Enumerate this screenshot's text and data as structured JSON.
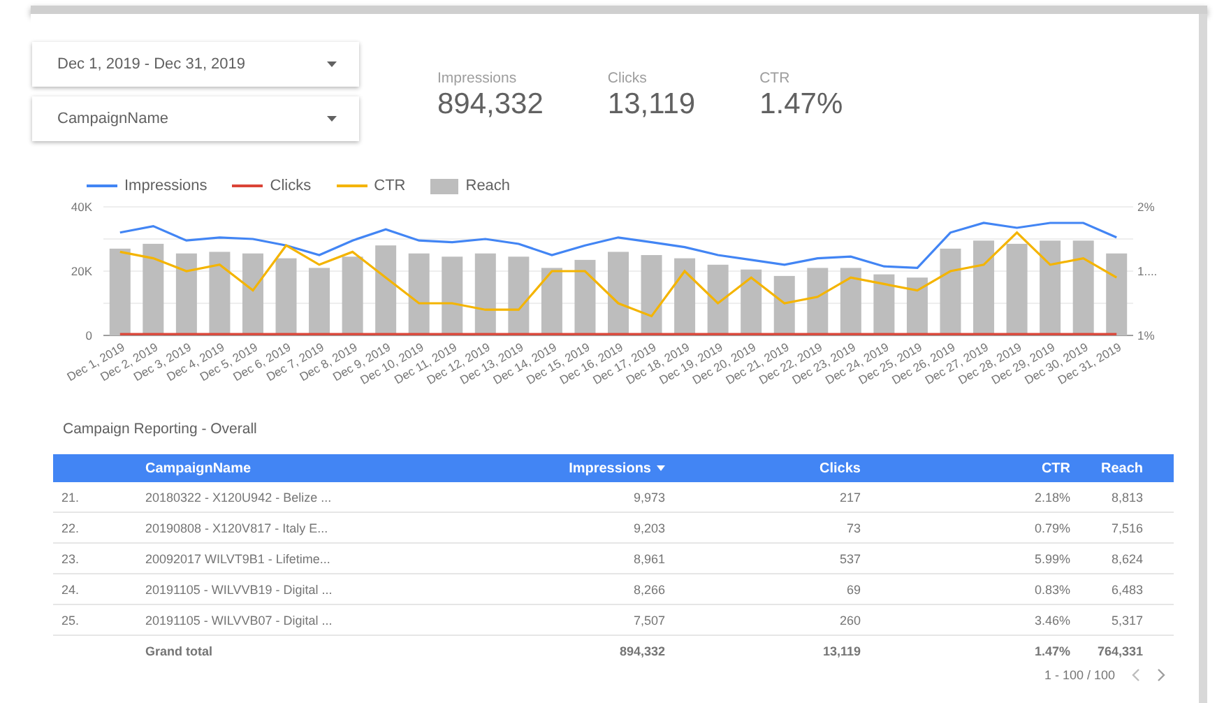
{
  "filters": [
    {
      "value": "Dec 1, 2019 - Dec 31, 2019"
    },
    {
      "value": "CampaignName"
    }
  ],
  "scorecards": [
    {
      "label": "Impressions",
      "value": "894,332"
    },
    {
      "label": "Clicks",
      "value": "13,119"
    },
    {
      "label": "CTR",
      "value": "1.47%"
    }
  ],
  "chart": {
    "chart_data": {
      "type": "bar",
      "categories": [
        "Dec 1, 2019",
        "Dec 2, 2019",
        "Dec 3, 2019",
        "Dec 4, 2019",
        "Dec 5, 2019",
        "Dec 6, 2019",
        "Dec 7, 2019",
        "Dec 8, 2019",
        "Dec 9, 2019",
        "Dec 10, 2019",
        "Dec 11, 2019",
        "Dec 12, 2019",
        "Dec 13, 2019",
        "Dec 14, 2019",
        "Dec 15, 2019",
        "Dec 16, 2019",
        "Dec 17, 2019",
        "Dec 18, 2019",
        "Dec 19, 2019",
        "Dec 20, 2019",
        "Dec 21, 2019",
        "Dec 22, 2019",
        "Dec 23, 2019",
        "Dec 24, 2019",
        "Dec 25, 2019",
        "Dec 26, 2019",
        "Dec 27, 2019",
        "Dec 28, 2019",
        "Dec 29, 2019",
        "Dec 30, 2019",
        "Dec 31, 2019"
      ],
      "ylim": [
        0,
        40000
      ],
      "yticks": [
        {
          "value": 0,
          "label": "0"
        },
        {
          "value": 20000,
          "label": "20K"
        },
        {
          "value": 40000,
          "label": "40K"
        }
      ],
      "y2lim": [
        1,
        2
      ],
      "y2ticks": [
        {
          "value": 1,
          "label": "1%"
        },
        {
          "value": 1.5,
          "label": "1...."
        },
        {
          "value": 2,
          "label": "2%"
        }
      ],
      "series": [
        {
          "name": "Impressions",
          "color": "#4285f4",
          "type": "line",
          "values": [
            32000,
            34000,
            29500,
            30500,
            30000,
            28000,
            25000,
            29500,
            33000,
            29500,
            29000,
            30000,
            28500,
            25000,
            28000,
            30500,
            29000,
            27500,
            25000,
            23500,
            22000,
            24000,
            24500,
            21500,
            21000,
            32000,
            35000,
            33500,
            35000,
            35000,
            30500
          ]
        },
        {
          "name": "Clicks",
          "color": "#db4437",
          "type": "line",
          "values": [
            400,
            400,
            400,
            400,
            400,
            400,
            400,
            400,
            400,
            400,
            400,
            400,
            400,
            400,
            400,
            400,
            400,
            400,
            400,
            400,
            400,
            400,
            400,
            400,
            400,
            400,
            400,
            400,
            400,
            400,
            400
          ]
        },
        {
          "name": "CTR",
          "color": "#f4b400",
          "type": "line",
          "axis": "y2",
          "values": [
            1.65,
            1.6,
            1.5,
            1.55,
            1.35,
            1.7,
            1.55,
            1.65,
            1.45,
            1.25,
            1.25,
            1.2,
            1.2,
            1.5,
            1.5,
            1.25,
            1.15,
            1.5,
            1.25,
            1.45,
            1.25,
            1.3,
            1.45,
            1.4,
            1.35,
            1.5,
            1.55,
            1.8,
            1.55,
            1.6,
            1.45
          ]
        },
        {
          "name": "Reach",
          "color": "#bdbdbd",
          "type": "bar",
          "values": [
            27000,
            28500,
            25500,
            26000,
            25500,
            24000,
            21000,
            24500,
            28000,
            25500,
            24500,
            25500,
            24500,
            21000,
            23500,
            26000,
            25000,
            24000,
            22000,
            20500,
            18500,
            21000,
            21000,
            19000,
            18000,
            27000,
            29500,
            28500,
            29500,
            29500,
            25500
          ]
        }
      ]
    }
  },
  "table": {
    "title": "Campaign Reporting - Overall",
    "columns": [
      {
        "label": "CampaignName",
        "sorted": false
      },
      {
        "label": "Impressions",
        "sorted": true
      },
      {
        "label": "Clicks",
        "sorted": false
      },
      {
        "label": "CTR",
        "sorted": false
      },
      {
        "label": "Reach",
        "sorted": false
      }
    ],
    "rows": [
      {
        "number": "21.",
        "cells": [
          "20180322 - X120U942 - Belize ...",
          "9,973",
          "217",
          "2.18%",
          "8,813"
        ]
      },
      {
        "number": "22.",
        "cells": [
          "20190808 - X120V817 - Italy E...",
          "9,203",
          "73",
          "0.79%",
          "7,516"
        ]
      },
      {
        "number": "23.",
        "cells": [
          "20092017 WILVT9B1 - Lifetime...",
          "8,961",
          "537",
          "5.99%",
          "8,624"
        ]
      },
      {
        "number": "24.",
        "cells": [
          "20191105 - WILVVB19 - Digital ...",
          "8,266",
          "69",
          "0.83%",
          "6,483"
        ]
      },
      {
        "number": "25.",
        "cells": [
          "20191105 - WILVVB07 - Digital ...",
          "7,507",
          "260",
          "3.46%",
          "5,317"
        ]
      }
    ],
    "total": {
      "label": "Grand total",
      "values": [
        "894,332",
        "13,119",
        "1.47%",
        "764,331"
      ]
    },
    "pagination": "1 - 100 / 100"
  }
}
